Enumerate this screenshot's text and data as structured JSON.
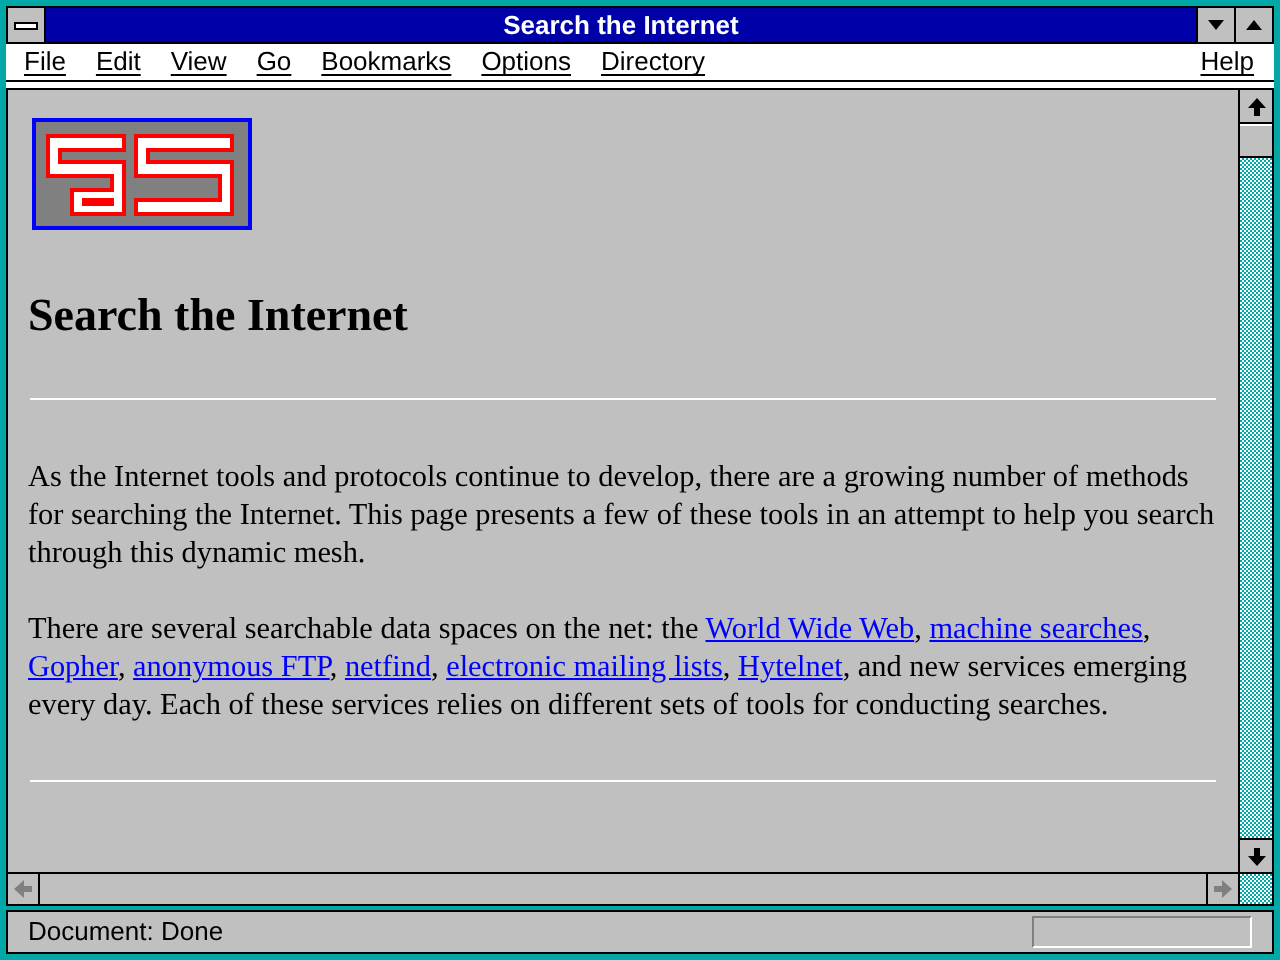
{
  "window": {
    "title": "Search the Internet"
  },
  "menu": [
    {
      "label": "File"
    },
    {
      "label": "Edit"
    },
    {
      "label": "View"
    },
    {
      "label": "Go"
    },
    {
      "label": "Bookmarks"
    },
    {
      "label": "Options"
    },
    {
      "label": "Directory"
    },
    {
      "label": "Help"
    }
  ],
  "page": {
    "heading": "Search the Internet",
    "paragraphs": [
      [
        {
          "kind": "text",
          "text": "As the Internet tools and protocols continue to develop, there are a growing number of methods for searching the Internet. This page presents a few of these tools in an attempt to help you search through this dynamic mesh."
        }
      ],
      [
        {
          "kind": "text",
          "text": "There are several searchable data spaces on the net: the "
        },
        {
          "kind": "link",
          "text": "World Wide Web"
        },
        {
          "kind": "text",
          "text": ", "
        },
        {
          "kind": "link",
          "text": "machine searches"
        },
        {
          "kind": "text",
          "text": ", "
        },
        {
          "kind": "link",
          "text": "Gopher"
        },
        {
          "kind": "text",
          "text": ", "
        },
        {
          "kind": "link",
          "text": "anonymous FTP"
        },
        {
          "kind": "text",
          "text": ", "
        },
        {
          "kind": "link",
          "text": "netfind"
        },
        {
          "kind": "text",
          "text": ", "
        },
        {
          "kind": "link",
          "text": "electronic mailing lists"
        },
        {
          "kind": "text",
          "text": ", "
        },
        {
          "kind": "link",
          "text": "Hytelnet"
        },
        {
          "kind": "text",
          "text": ", and new services emerging every day. Each of these services relies on different sets of tools for conducting searches."
        }
      ]
    ]
  },
  "status_bar": {
    "text": "Document: Done"
  }
}
